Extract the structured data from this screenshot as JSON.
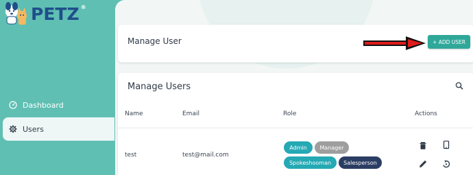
{
  "brand": {
    "name": "PETZ",
    "reg": "®"
  },
  "sidebar": {
    "items": [
      {
        "label": "Dashboard",
        "icon": "dashboard-gauge-icon"
      },
      {
        "label": "Users",
        "icon": "gear-icon",
        "active": true
      }
    ]
  },
  "header": {
    "title": "Manage User",
    "add_button_label": "+ ADD USER"
  },
  "table": {
    "title": "Manage Users",
    "columns": [
      "Name",
      "Email",
      "Role",
      "Actions"
    ],
    "rows": [
      {
        "name": "test",
        "email": "test@mail.com",
        "roles": [
          "Admin",
          "Manager",
          "Spokeshooman",
          "Salesperson"
        ]
      }
    ]
  },
  "colors": {
    "sidebar": "#5fbfb3",
    "accent": "#2fa89a",
    "chip_teal": "#25a9b4",
    "chip_gray": "#9e9e9e",
    "chip_navy": "#2b3d63",
    "annotation_arrow": "#e01b1b"
  }
}
